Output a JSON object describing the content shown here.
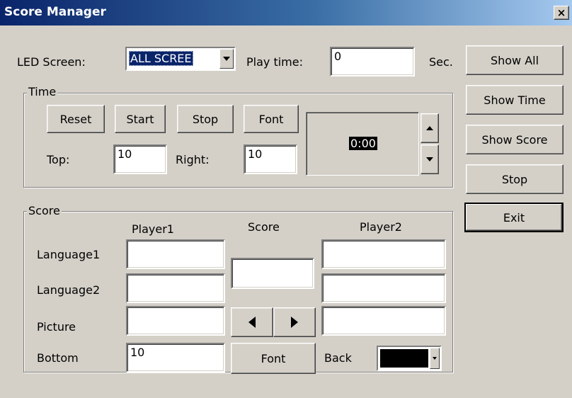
{
  "window": {
    "title": "Score Manager",
    "close_glyph": "×"
  },
  "top": {
    "led_label": "LED Screen:",
    "led_value": "ALL SCREE",
    "playtime_label": "Play time:",
    "playtime_value": "0",
    "sec_label": "Sec."
  },
  "side_buttons": {
    "show_all": "Show All",
    "show_time": "Show Time",
    "show_score": "Show Score",
    "stop": "Stop",
    "exit": "Exit"
  },
  "time_group": {
    "title": "Time",
    "reset": "Reset",
    "start": "Start",
    "stop": "Stop",
    "font": "Font",
    "top_label": "Top:",
    "top_value": "10",
    "right_label": "Right:",
    "right_value": "10",
    "clock": "0:00"
  },
  "score_group": {
    "title": "Score",
    "player1_header": "Player1",
    "score_header": "Score",
    "player2_header": "Player2",
    "row_language1": "Language1",
    "row_language2": "Language2",
    "row_picture": "Picture",
    "row_bottom": "Bottom",
    "bottom_value": "10",
    "font": "Font",
    "back_label": "Back",
    "back_color": "#000000",
    "player1_lang1": "",
    "player1_lang2": "",
    "player1_picture": "",
    "player2_lang1": "",
    "player2_lang2": "",
    "player2_picture": "",
    "score_value": ""
  }
}
